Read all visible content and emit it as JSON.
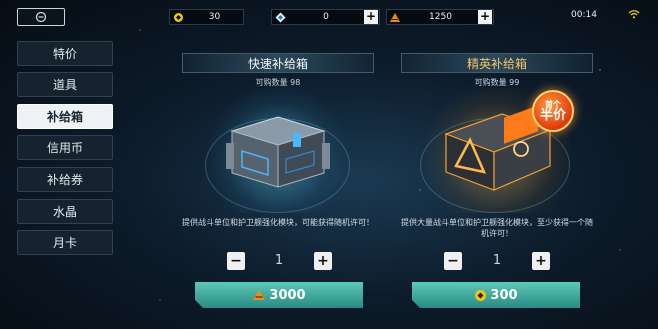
{
  "topbar": {
    "credits_value": "30",
    "crystal_value": "0",
    "alloy_value": "1250",
    "clock": "00:14"
  },
  "sidebar": {
    "items": [
      {
        "label": "特价"
      },
      {
        "label": "道具"
      },
      {
        "label": "补给箱",
        "active": true
      },
      {
        "label": "信用币"
      },
      {
        "label": "补给券"
      },
      {
        "label": "水晶"
      },
      {
        "label": "月卡"
      }
    ]
  },
  "boxes": [
    {
      "title": "快速补给箱",
      "quantity_label": "可购数量 98",
      "description": "提供战斗单位和护卫舰强化模块，可能获得随机许可！",
      "count": "1",
      "price": "3000",
      "currency_icon": "alloy-icon"
    },
    {
      "title": "精英补给箱",
      "quantity_label": "可购数量 99",
      "description": "提供大量战斗单位和护卫舰强化模块，至少获得一个随机许可！",
      "count": "1",
      "price": "300",
      "currency_icon": "credits-icon",
      "badge_line1": "首个",
      "badge_line2": "半价"
    }
  ],
  "colors": {
    "accent_teal": "#3fae9f",
    "elite_gold": "#f1c46a",
    "badge_red": "#e03a0c"
  }
}
